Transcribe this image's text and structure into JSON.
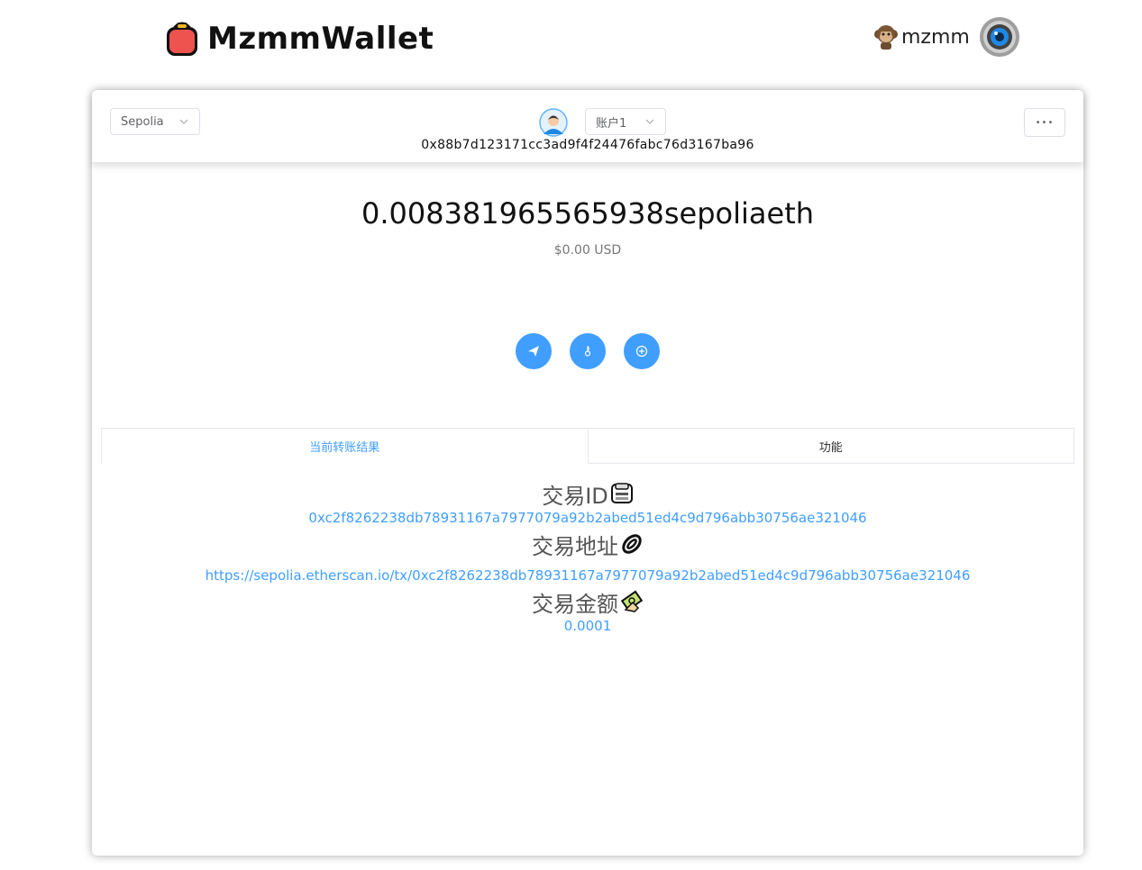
{
  "app": {
    "title": "MzmmWallet"
  },
  "user": {
    "name": "mzmm"
  },
  "header": {
    "network": "Sepolia",
    "account": "账户1",
    "address": "0x88b7d123171cc3ad9f4f24476fabc76d3167ba96",
    "more_label": "•••"
  },
  "balance": {
    "amount": "0.008381965565938sepoliaeth",
    "usd": "$0.00 USD"
  },
  "actions": [
    {
      "icon": "send-icon"
    },
    {
      "icon": "key-icon"
    },
    {
      "icon": "add-circle-icon"
    }
  ],
  "tabs": [
    {
      "label": "当前转账结果",
      "active": true
    },
    {
      "label": "功能",
      "active": false
    }
  ],
  "result": {
    "tx_id_label": "交易ID",
    "tx_id": "0xc2f8262238db78931167a7977079a92b2abed51ed4c9d796abb30756ae321046",
    "tx_url_label": "交易地址",
    "tx_url": "https://sepolia.etherscan.io/tx/0xc2f8262238db78931167a7977079a92b2abed51ed4c9d796abb30756ae321046",
    "amount_label": "交易金额",
    "amount": "0.0001"
  },
  "colors": {
    "accent": "#409eff",
    "logo": "#e94e4e"
  }
}
